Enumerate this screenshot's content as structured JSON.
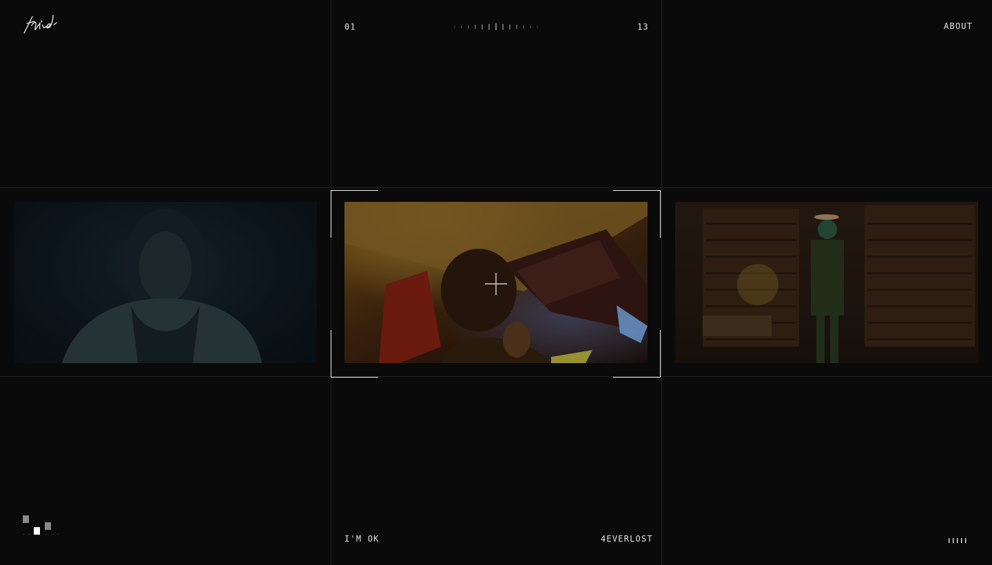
{
  "header": {
    "brand_logo_text": "third",
    "counter_current": "01",
    "counter_total": "13",
    "nav_about": "ABOUT"
  },
  "slider": {
    "tick_count": 13,
    "active_index": 6
  },
  "projects": {
    "current_title": "I'M OK",
    "next_title": "4EVERLOST"
  },
  "icons": {
    "bottom_left": "pixel-squares-icon",
    "bottom_right": "sound-bars-icon",
    "center": "crosshair-icon"
  },
  "colors": {
    "background": "#0a0a0a",
    "grid_line": "#232323",
    "text": "#e6e6e6",
    "frame_corner": "#f4f4f4"
  }
}
